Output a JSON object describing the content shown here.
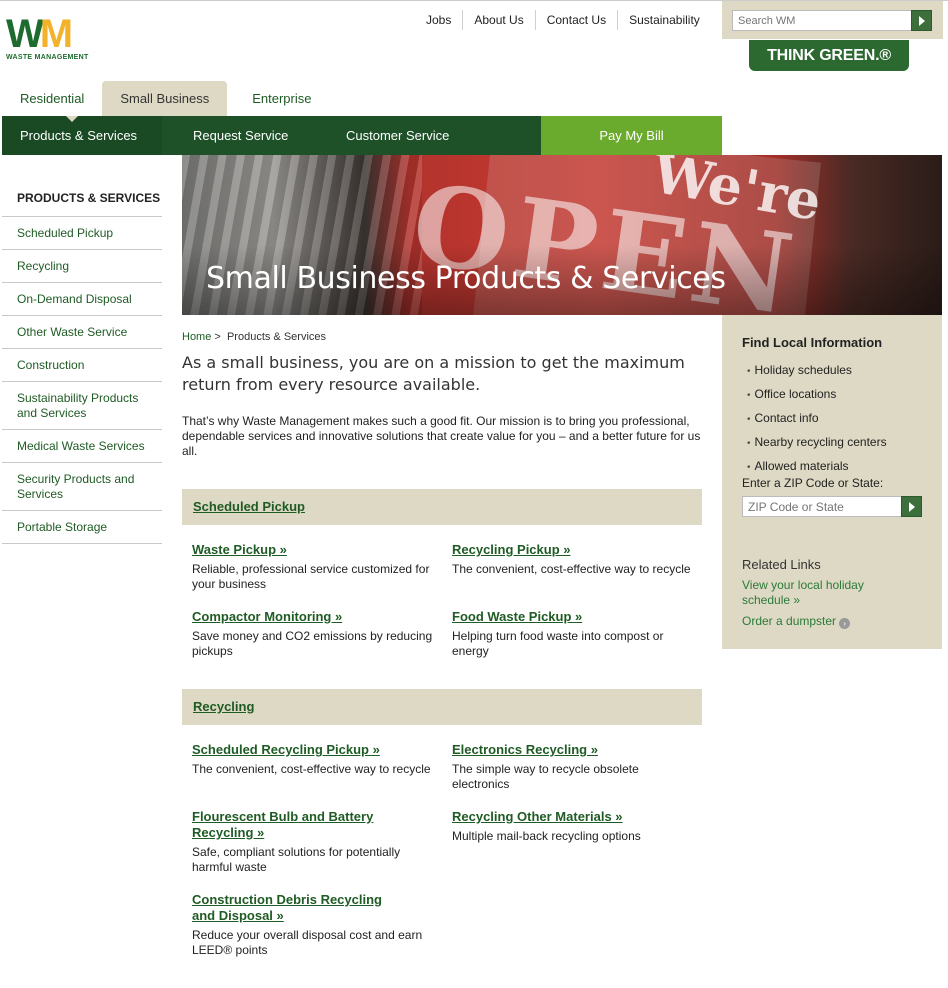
{
  "brand": {
    "logo_letters_w": "W",
    "logo_letters_m": "M",
    "logo_tagline": "WASTE MANAGEMENT",
    "think_green": "THINK GREEN.®",
    "green": "#1e5128",
    "accent": "#6aaa2c",
    "tan": "#ddd9c4"
  },
  "utility_nav": [
    "Jobs",
    "About Us",
    "Contact Us",
    "Sustainability"
  ],
  "search": {
    "placeholder": "Search WM",
    "button_icon": "arrow-right-icon"
  },
  "segment_tabs": [
    "Residential",
    "Small Business",
    "Enterprise"
  ],
  "main_nav": {
    "products": "Products & Services",
    "request": "Request Service",
    "customer": "Customer Service",
    "pay": "Pay My Bill"
  },
  "hero": {
    "title": "Small Business Products & Services",
    "sign_word": "OPEN",
    "sign_top": "We're"
  },
  "sidebar": {
    "heading": "PRODUCTS & SERVICES",
    "items": [
      "Scheduled Pickup",
      "Recycling",
      "On-Demand Disposal",
      "Other Waste Service",
      "Construction",
      "Sustainability Products and Services",
      "Medical Waste Services",
      "Security Products and Services",
      "Portable Storage"
    ]
  },
  "breadcrumb": {
    "home": "Home",
    "separator": ">",
    "current": "Products & Services"
  },
  "intro": {
    "lead": "As a small business, you are on a mission to get the maximum return from every resource available.",
    "body": "That’s why Waste Management makes such a good fit. Our mission is to bring you professional, dependable services and innovative solutions that create value for you – and a better future for us all."
  },
  "sections": [
    {
      "title": "Scheduled Pickup",
      "cards": [
        {
          "title": "Waste Pickup »",
          "desc": "Reliable, professional service customized for your business"
        },
        {
          "title": "Recycling Pickup »",
          "desc": "The convenient, cost-effective way to recycle"
        },
        {
          "title": "Compactor Monitoring  »",
          "desc": "Save money and CO2 emissions by reducing pickups"
        },
        {
          "title": "Food Waste Pickup »",
          "desc": "Helping turn food waste into compost or energy"
        }
      ]
    },
    {
      "title": "Recycling",
      "cards": [
        {
          "title": "Scheduled Recycling Pickup »",
          "desc": "The convenient, cost-effective way to recycle"
        },
        {
          "title": "Electronics Recycling »",
          "desc": "The simple way to recycle obsolete electronics"
        },
        {
          "title": "Flourescent Bulb and Battery Recycling »",
          "desc": "Safe, compliant solutions for potentially harmful waste"
        },
        {
          "title": "Recycling Other Materials »",
          "desc": "Multiple mail-back recycling options"
        },
        {
          "title": "Construction Debris Recycling and Disposal »",
          "desc": "Reduce your overall disposal cost and earn LEED® points"
        }
      ]
    }
  ],
  "right_panel": {
    "heading": "Find Local Information",
    "items": [
      "Holiday schedules",
      "Office locations",
      "Contact info",
      "Nearby recycling centers",
      "Allowed materials"
    ],
    "zip_label": "Enter a ZIP Code or State:",
    "zip_placeholder": "ZIP Code or State",
    "related_heading": "Related Links",
    "link_holiday": "View your local holiday schedule »",
    "link_dumpster": "Order a dumpster",
    "link_dumpster_icon": "external-link-icon"
  }
}
